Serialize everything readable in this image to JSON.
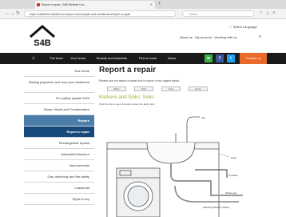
{
  "browser": {
    "tab_title": "Report a repair | S4B Website Lim...",
    "url": "https://s4bstreets.resident.co.uk/your-home/repairs-and-maintenance/report-a-repair",
    "search_placeholder": "Search",
    "new_tab": "+",
    "colors": {
      "close": "#ec5f57",
      "min": "#f4bf4f",
      "max": "#62c554"
    }
  },
  "header": {
    "logo_text": "S4B",
    "select_language": "Select Language",
    "about_us": "About us",
    "my_account": "My account",
    "working_with_us": "Working with us",
    "search_icon": "search-icon"
  },
  "nav": {
    "items": [
      "The team",
      "Your home",
      "Tenants and residents",
      "Find a home",
      "News"
    ],
    "contact": "Contact us",
    "social": [
      {
        "name": "whatsapp",
        "glyph": "w",
        "color": "#3fae49"
      },
      {
        "name": "facebook",
        "glyph": "f",
        "color": "#3b5998"
      },
      {
        "name": "twitter",
        "glyph": "t",
        "color": "#1da1f2"
      }
    ]
  },
  "sidebar": {
    "items": [
      "Your home",
      "Making payments and view your statement",
      "Fire safety update 2020",
      "Damp, Mould and Condensation",
      "Repairs",
      "Report a repair",
      "Rechargeable repairs",
      "Antisocial behaviour",
      "Improvements",
      "Gas, electricity and fire safety",
      "Leasehold",
      "Right to buy"
    ]
  },
  "main": {
    "title": "Report a repair",
    "intro": "Please use our report a repair tool to report a non urgent repair.",
    "buttons": [
      "Back",
      "Start",
      "Next",
      "Home"
    ],
    "section_title": "Kitchens and Sinks: Sinks",
    "diagram_caption": "Click the link to see information about the faulty part.",
    "diagram_labels": [
      "Tap",
      "Drain",
      "Overflow",
      "Waste pipe",
      "Washing Machine Waste"
    ]
  }
}
